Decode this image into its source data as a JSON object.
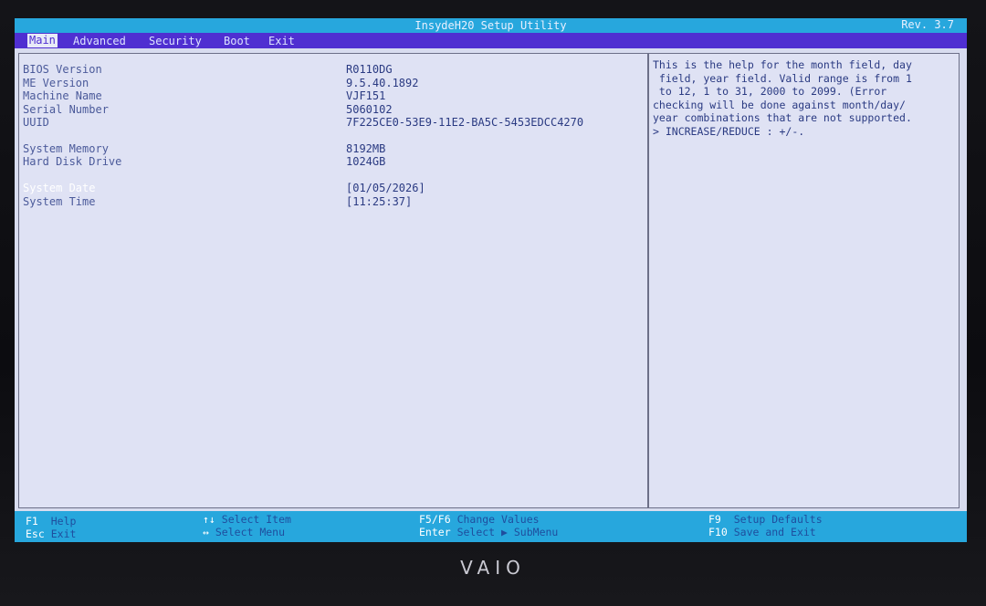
{
  "titlebar": {
    "title": "InsydeH20 Setup Utility",
    "revision": "Rev. 3.7"
  },
  "menu": {
    "tabs": [
      "Main",
      "Advanced",
      "Security",
      "Boot",
      "Exit"
    ],
    "active_tab": "Main"
  },
  "main": {
    "rows": [
      {
        "label": "BIOS Version",
        "value": "R0110DG"
      },
      {
        "label": "ME Version",
        "value": "9.5.40.1892"
      },
      {
        "label": "Machine Name",
        "value": "VJF151"
      },
      {
        "label": "Serial Number",
        "value": "5060102"
      },
      {
        "label": "UUID",
        "value": "7F225CE0-53E9-11E2-BA5C-5453EDCC4270"
      },
      {
        "label": "System Memory",
        "value": "8192MB"
      },
      {
        "label": "Hard Disk Drive",
        "value": "1024GB"
      },
      {
        "label": "System Date",
        "value": "[01/05/2026]"
      },
      {
        "label": "System Time",
        "value": "[11:25:37]"
      }
    ],
    "selected_row": "System Date"
  },
  "help": {
    "text": "This is the help for the month field, day\n field, year field. Valid range is from 1\n to 12, 1 to 31, 2000 to 2099. (Error\nchecking will be done against month/day/\nyear combinations that are not supported.\n> INCREASE/REDUCE : +/-."
  },
  "footer": {
    "items": [
      {
        "key": "F1",
        "desc": "Help"
      },
      {
        "key": "Esc",
        "desc": "Exit"
      },
      {
        "key": "↑↓",
        "desc": "Select Item"
      },
      {
        "key": "↔",
        "desc": "Select Menu"
      },
      {
        "key": "F5/F6",
        "desc": "Change Values"
      },
      {
        "key": "Enter",
        "desc": "Select ▶ SubMenu"
      },
      {
        "key": "F9",
        "desc": "Setup Defaults"
      },
      {
        "key": "F10",
        "desc": "Save and Exit"
      }
    ]
  },
  "brand": {
    "logo": "VAIO"
  },
  "colors": {
    "titlebar": "#27a7dd",
    "menubar": "#4f2fd1",
    "panel": "#dfe2f4",
    "text": "#2a3a82"
  }
}
